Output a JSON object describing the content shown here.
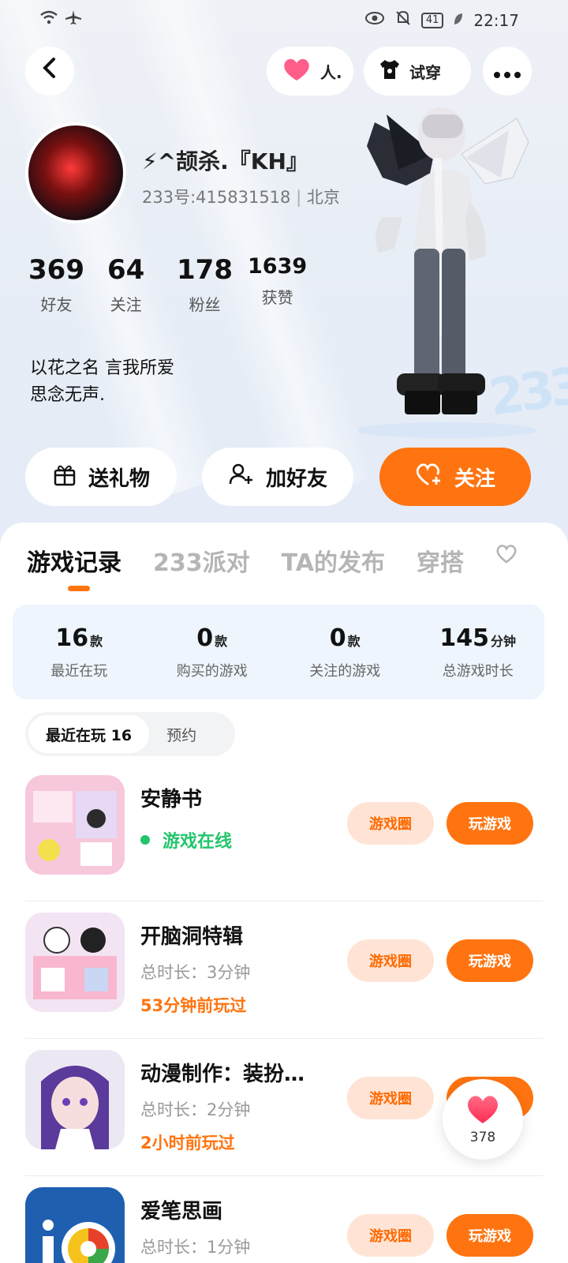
{
  "status": {
    "time": "22:17",
    "battery": "41"
  },
  "header": {
    "follow_pill_label": "人.",
    "tryon_label": "试穿"
  },
  "profile": {
    "name": "⚡^颉杀.『KH』",
    "uid_line": "233号:415831518",
    "location": "北京",
    "stats": [
      {
        "value": "369",
        "label": "好友"
      },
      {
        "value": "64",
        "label": "关注"
      },
      {
        "value": "178",
        "label": "粉丝"
      },
      {
        "value": "1639",
        "label": "获赞"
      }
    ],
    "bio_line1": "以花之名 言我所爱",
    "bio_line2": "思念无声."
  },
  "actions": {
    "gift": "送礼物",
    "add_friend": "加好友",
    "follow": "关注"
  },
  "tabs": [
    "游戏记录",
    "233派对",
    "TA的发布",
    "穿搭"
  ],
  "summary": [
    {
      "value": "16",
      "unit": "款",
      "label": "最近在玩"
    },
    {
      "value": "0",
      "unit": "款",
      "label": "购买的游戏"
    },
    {
      "value": "0",
      "unit": "款",
      "label": "关注的游戏"
    },
    {
      "value": "145",
      "unit": "分钟",
      "label": "总游戏时长"
    }
  ],
  "segment": {
    "active": "最近在玩 16",
    "inactive": "预约"
  },
  "games": [
    {
      "title": "安静书",
      "online": "游戏在线",
      "circle_label": "游戏圈",
      "play_label": "玩游戏",
      "icon_color": "#f6c1d8"
    },
    {
      "title": "开脑洞特辑",
      "duration": "总时长：3分钟",
      "last_played": "53分钟前玩过",
      "circle_label": "游戏圈",
      "play_label": "玩游戏",
      "icon_color": "#f4e6f6"
    },
    {
      "title": "动漫制作：装扮…",
      "duration": "总时长：2分钟",
      "last_played": "2小时前玩过",
      "circle_label": "游戏圈",
      "play_label": "玩游戏",
      "icon_color": "#6a4ba8"
    },
    {
      "title": "爱笔思画",
      "duration": "总时长：1分钟",
      "circle_label": "游戏圈",
      "play_label": "玩游戏",
      "icon_color": "#1f5fb0"
    }
  ],
  "float_like": {
    "count": "378"
  },
  "colors": {
    "accent": "#ff7410",
    "online": "#22c56c",
    "summary_bg": "#eef5fd"
  }
}
